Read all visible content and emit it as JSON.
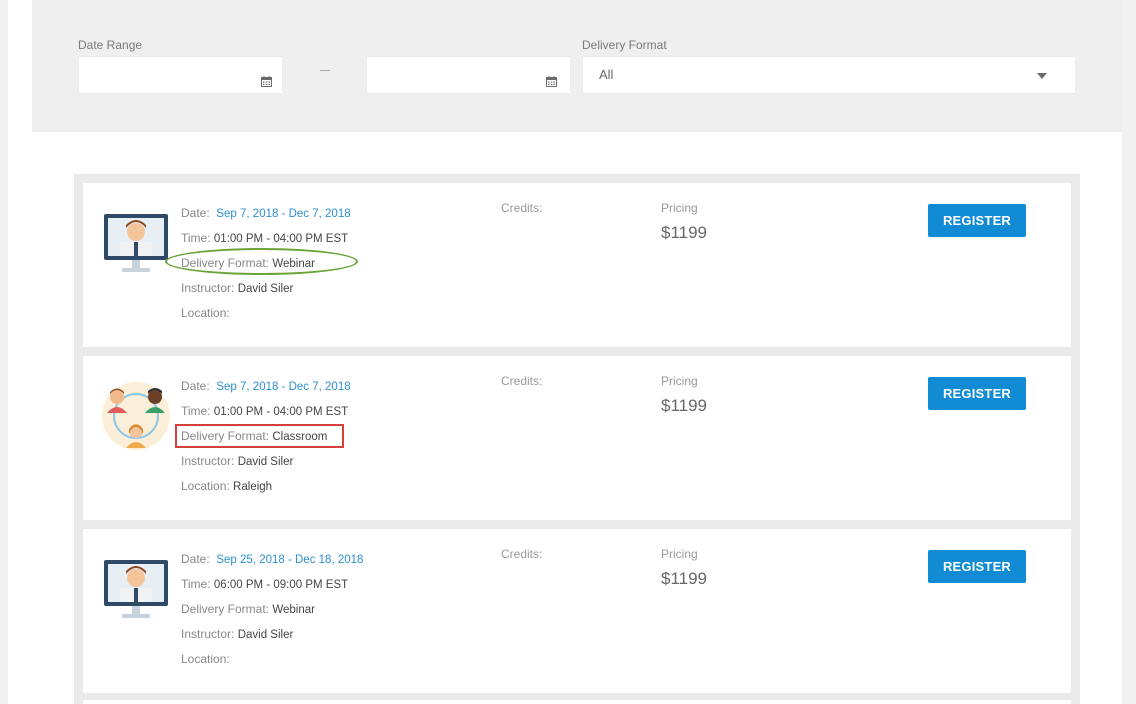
{
  "filters": {
    "date_range_label": "Date Range",
    "start_date_value": "",
    "end_date_value": "",
    "separator": "–",
    "delivery_format_label": "Delivery Format",
    "delivery_format_value": "All"
  },
  "icons": {
    "calendar": "calendar-icon",
    "dropdown": "chevron-down-icon",
    "webinar": "webinar-instructor-icon",
    "classroom": "classroom-group-icon"
  },
  "colors": {
    "accent": "#118bd4",
    "date_link": "#2d8fd3",
    "annotation_green": "#6aa437",
    "annotation_red": "#d6403b"
  },
  "courses": [
    {
      "date_label": "Date:",
      "date_value": "Sep 7, 2018 - Dec 7, 2018",
      "time_label": "Time:",
      "time_value": "01:00 PM - 04:00 PM EST",
      "format_label": "Delivery Format:",
      "format_value": "Webinar",
      "instructor_label": "Instructor:",
      "instructor_value": "David Siler",
      "location_label": "Location:",
      "location_value": "",
      "credits_label": "Credits:",
      "pricing_label": "Pricing",
      "price": "$1199",
      "register_label": "REGISTER"
    },
    {
      "date_label": "Date:",
      "date_value": "Sep 7, 2018 - Dec 7, 2018",
      "time_label": "Time:",
      "time_value": "01:00 PM - 04:00 PM EST",
      "format_label": "Delivery Format:",
      "format_value": "Classroom",
      "instructor_label": "Instructor:",
      "instructor_value": "David Siler",
      "location_label": "Location:",
      "location_value": "Raleigh",
      "credits_label": "Credits:",
      "pricing_label": "Pricing",
      "price": "$1199",
      "register_label": "REGISTER"
    },
    {
      "date_label": "Date:",
      "date_value": "Sep 25, 2018 - Dec 18, 2018",
      "time_label": "Time:",
      "time_value": "06:00 PM - 09:00 PM EST",
      "format_label": "Delivery Format:",
      "format_value": "Webinar",
      "instructor_label": "Instructor:",
      "instructor_value": "David Siler",
      "location_label": "Location:",
      "location_value": "",
      "credits_label": "Credits:",
      "pricing_label": "Pricing",
      "price": "$1199",
      "register_label": "REGISTER"
    }
  ]
}
